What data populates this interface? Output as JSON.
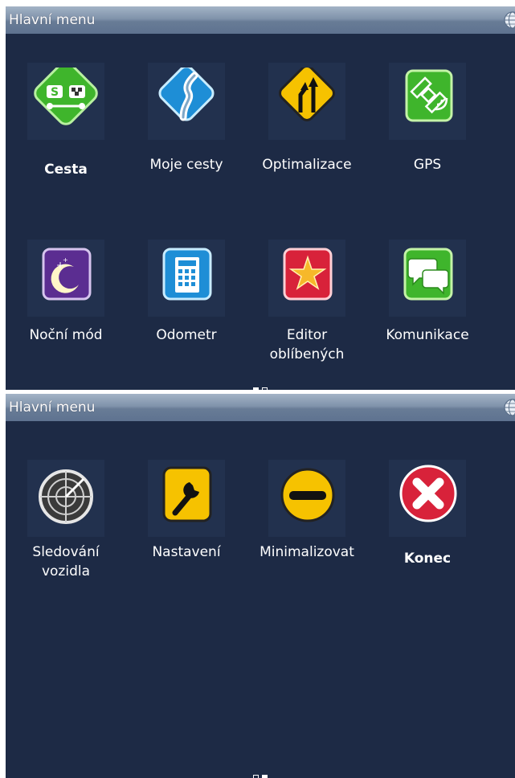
{
  "screen1": {
    "title": "Hlavní menu",
    "items": [
      {
        "label": "Cesta",
        "icon": "route-icon"
      },
      {
        "label": "Moje cesty",
        "icon": "my-routes-icon"
      },
      {
        "label": "Optimalizace",
        "icon": "optimize-icon"
      },
      {
        "label": "GPS",
        "icon": "gps-satellite-icon"
      },
      {
        "label": "Noční mód",
        "icon": "night-mode-icon"
      },
      {
        "label": "Odometr",
        "icon": "calculator-icon"
      },
      {
        "label": "Editor oblíbených",
        "line1": "Editor",
        "line2": "oblíbených",
        "icon": "star-icon"
      },
      {
        "label": "Komunikace",
        "icon": "chat-icon"
      }
    ],
    "page_indicator": {
      "current": 1,
      "total": 2
    }
  },
  "screen2": {
    "title": "Hlavní menu",
    "items": [
      {
        "label": "Sledování vozidla",
        "line1": "Sledování",
        "line2": "vozidla",
        "icon": "radar-icon"
      },
      {
        "label": "Nastavení",
        "icon": "wrench-icon"
      },
      {
        "label": "Minimalizovat",
        "icon": "minimize-icon"
      },
      {
        "label": "Konec",
        "icon": "exit-icon"
      }
    ],
    "page_indicator": {
      "current": 2,
      "total": 2
    }
  },
  "colors": {
    "background": "#1d2a45",
    "titlebar": "#8093ab",
    "green": "#3fb52c",
    "blue": "#1e8ed6",
    "yellow": "#f6c200",
    "purple": "#5b2d91",
    "red": "#d8223a"
  }
}
